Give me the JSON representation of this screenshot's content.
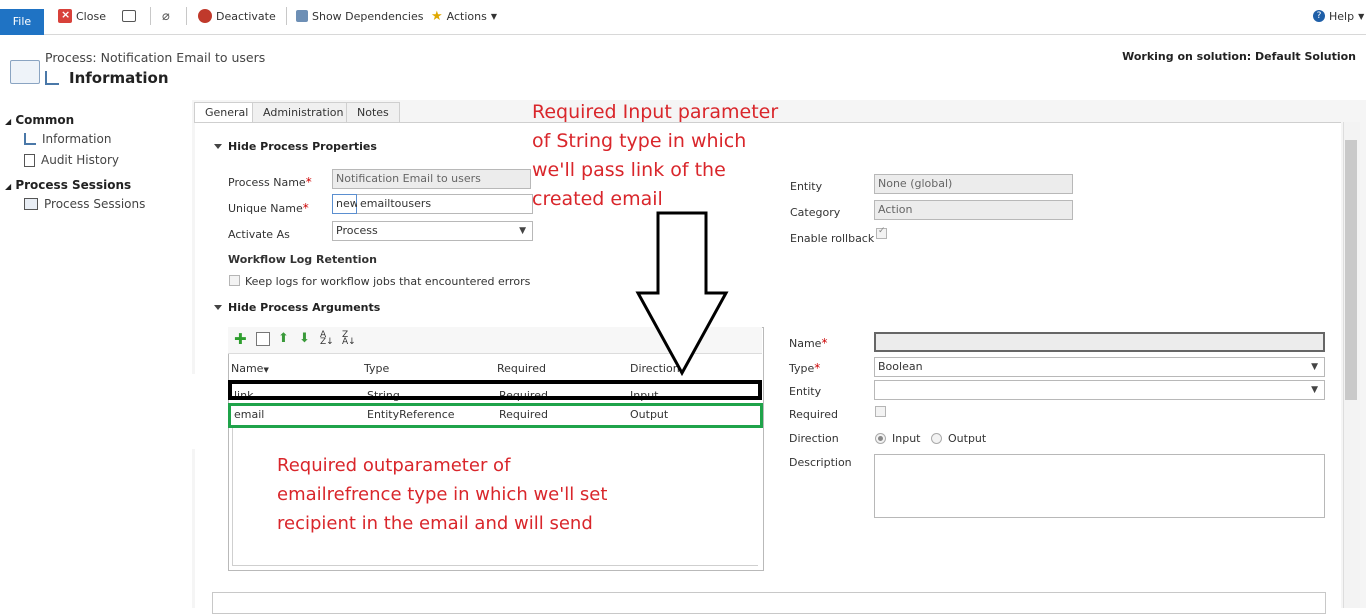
{
  "ribbon": {
    "file": "File",
    "close": "Close",
    "deactivate": "Deactivate",
    "show_dependencies": "Show Dependencies",
    "actions": "Actions",
    "help": "Help"
  },
  "header": {
    "subtitle": "Process: Notification Email to users",
    "title": "Information",
    "solution": "Working on solution: Default Solution"
  },
  "nav": {
    "common": "Common",
    "information": "Information",
    "audit_history": "Audit History",
    "process_sessions_section": "Process Sessions",
    "process_sessions": "Process Sessions"
  },
  "tabs": [
    "General",
    "Administration",
    "Notes"
  ],
  "properties": {
    "section": "Hide Process Properties",
    "process_name_label": "Process Name",
    "process_name_value": "Notification Email to users",
    "unique_name_label": "Unique Name",
    "unique_prefix": "new_",
    "unique_value": "emailtousers",
    "activate_as_label": "Activate As",
    "activate_as_value": "Process",
    "log_retention_label": "Workflow Log Retention",
    "keep_logs_label": "Keep logs for workflow jobs that encountered errors",
    "entity_label": "Entity",
    "entity_value": "None (global)",
    "category_label": "Category",
    "category_value": "Action",
    "rollback_label": "Enable rollback"
  },
  "arguments": {
    "section": "Hide Process Arguments",
    "columns": [
      "Name",
      "Type",
      "Required",
      "Direction"
    ],
    "rows": [
      {
        "name": "link",
        "type": "String",
        "required": "Required",
        "direction": "Input"
      },
      {
        "name": "email",
        "type": "EntityReference",
        "required": "Required",
        "direction": "Output"
      }
    ]
  },
  "detail": {
    "name_label": "Name",
    "type_label": "Type",
    "type_value": "Boolean",
    "entity_label": "Entity",
    "required_label": "Required",
    "direction_label": "Direction",
    "input_label": "Input",
    "output_label": "Output",
    "description_label": "Description"
  },
  "annotations": {
    "input_note": [
      "Required Input parameter",
      "of String type in which",
      "we'll pass link of the",
      "created email"
    ],
    "output_note": [
      "Required outparameter of",
      "emailrefrence type in which we'll set",
      "recipient in the email and will send"
    ]
  },
  "colors": {
    "annotation": "#d9262b",
    "input_box": "#000000",
    "output_box": "#1fa34a",
    "file_button": "#1f73c4"
  }
}
